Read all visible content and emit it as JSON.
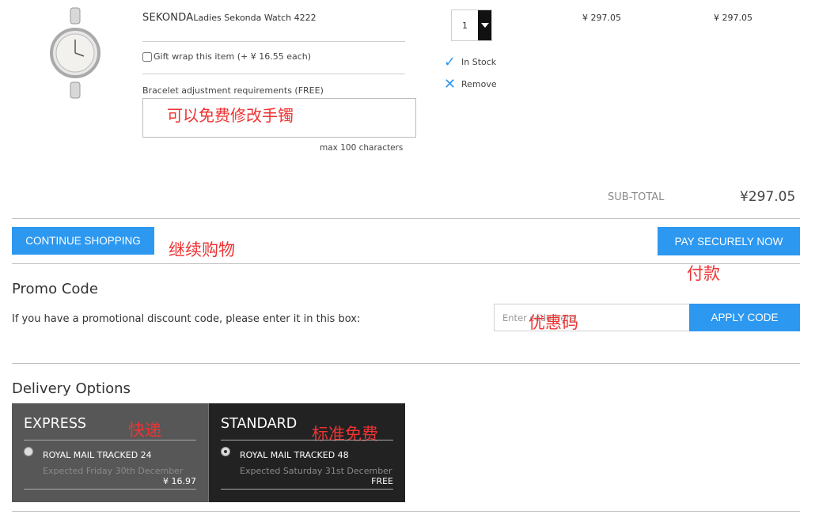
{
  "product": {
    "brand": "SEKONDA",
    "name": "Ladies Sekonda Watch 4222",
    "gift_wrap_label": "Gift wrap this item (+ ¥ 16.55 each)",
    "bracelet_label": "Bracelet adjustment requirements (FREE)",
    "bracelet_value": "可以免费修改手镯",
    "max_chars": "max 100 characters",
    "quantity": "1",
    "stock_status": "In Stock",
    "remove_label": "Remove",
    "unit_price": "¥ 297.05",
    "line_total": "¥ 297.05"
  },
  "subtotal": {
    "label": "SUB-TOTAL",
    "value": "¥297.05"
  },
  "actions": {
    "continue_label": "CONTINUE SHOPPING",
    "continue_note": "继续购物",
    "pay_label": "PAY SECURELY NOW",
    "pay_note": "付款"
  },
  "promo": {
    "title": "Promo Code",
    "description": "If you have a promotional discount code, please enter it in this box:",
    "placeholder": "Enter code here",
    "note": "优惠码",
    "apply_label": "APPLY CODE"
  },
  "delivery": {
    "title": "Delivery Options",
    "options": [
      {
        "title": "EXPRESS",
        "note": "快递",
        "service": "ROYAL MAIL TRACKED 24",
        "expected": "Expected Friday 30th December",
        "price": "¥ 16.97",
        "selected": false
      },
      {
        "title": "STANDARD",
        "note": "标准免费",
        "service": "ROYAL MAIL TRACKED 48",
        "expected": "Expected Saturday 31st December",
        "price": "FREE",
        "selected": true
      }
    ]
  },
  "colors": {
    "accent": "#2d98f0",
    "annotation": "#e33333"
  }
}
